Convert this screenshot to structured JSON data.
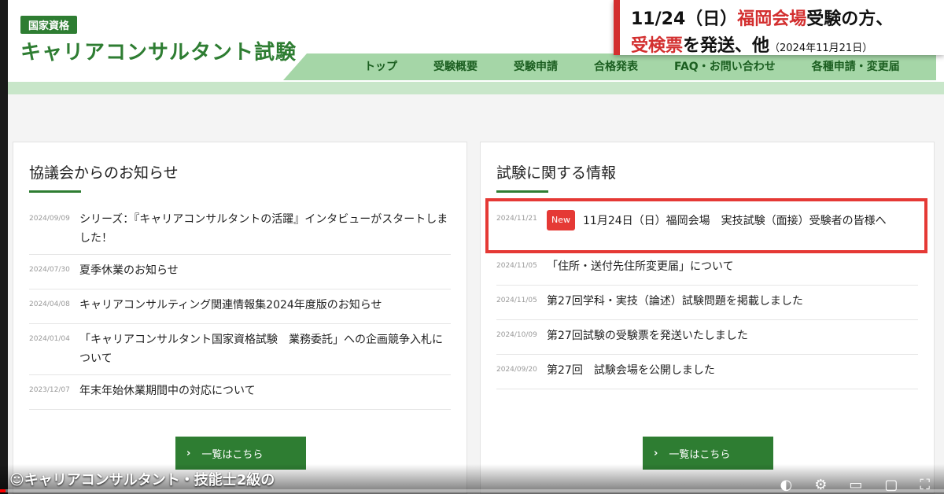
{
  "header": {
    "badge": "国家資格",
    "title": "キャリアコンサルタント試験",
    "nav": [
      "トップ",
      "受験概要",
      "受験申請",
      "合格発表",
      "FAQ・お問い合わせ",
      "各種申請・変更届"
    ]
  },
  "overlay": {
    "line1_prefix": "11/24（日）",
    "line1_red": "福岡会場",
    "line1_suffix": "受験の方、",
    "line2_red": "受検票",
    "line2_suffix": "を発送、他",
    "date": "（2024年11月21日）"
  },
  "left_panel": {
    "title": "協議会からのお知らせ",
    "items": [
      {
        "date": "2024/09/09",
        "text": "シリーズ：『キャリアコンサルタントの活躍』インタビューがスタートしました！"
      },
      {
        "date": "2024/07/30",
        "text": "夏季休業のお知らせ"
      },
      {
        "date": "2024/04/08",
        "text": "キャリアコンサルティング関連情報集2024年度版のお知らせ"
      },
      {
        "date": "2024/01/04",
        "text": "「キャリアコンサルタント国家資格試験　業務委託」への企画競争入札について"
      },
      {
        "date": "2023/12/07",
        "text": "年末年始休業期間中の対応について"
      }
    ],
    "more": "一覧はこちら"
  },
  "right_panel": {
    "title": "試験に関する情報",
    "new_label": "New",
    "items": [
      {
        "date": "2024/11/21",
        "text": "11月24日（日）福岡会場　実技試験（面接）受験者の皆様へ"
      },
      {
        "date": "2024/11/05",
        "text": "「住所・送付先住所変更届」について"
      },
      {
        "date": "2024/11/05",
        "text": "第27回学科・実技（論述）試験問題を掲載しました"
      },
      {
        "date": "2024/10/09",
        "text": "第27回試験の受験票を発送いたしました"
      },
      {
        "date": "2024/09/20",
        "text": "第27回　試験会場を公開しました"
      }
    ],
    "more": "一覧はこちら"
  },
  "video": {
    "title": "☺キャリアコンサルタント・技能士2級の",
    "progress": 0.006
  },
  "icons": {
    "chevron": "chevron-right-icon"
  }
}
